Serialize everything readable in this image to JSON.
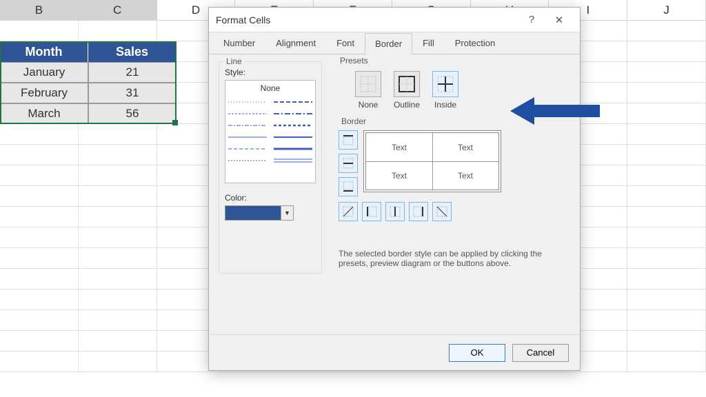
{
  "columns": [
    "B",
    "C",
    "D",
    "E",
    "F",
    "G",
    "H",
    "I",
    "J"
  ],
  "table": {
    "headers": [
      "Month",
      "Sales"
    ],
    "rows": [
      [
        "January",
        "21"
      ],
      [
        "February",
        "31"
      ],
      [
        "March",
        "56"
      ]
    ]
  },
  "dialog": {
    "title": "Format Cells",
    "help": "?",
    "close": "✕",
    "tabs": [
      "Number",
      "Alignment",
      "Font",
      "Border",
      "Fill",
      "Protection"
    ],
    "active_tab": "Border",
    "line": {
      "group": "Line",
      "style_label": "Style:",
      "none": "None",
      "color_label": "Color:",
      "color_value": "#2f5597"
    },
    "presets": {
      "group": "Presets",
      "items": [
        "None",
        "Outline",
        "Inside"
      ]
    },
    "border": {
      "group": "Border",
      "preview_text": "Text"
    },
    "hint": "The selected border style can be applied by clicking the presets, preview diagram or the buttons above.",
    "ok": "OK",
    "cancel": "Cancel"
  },
  "chart_data": {
    "type": "table",
    "title": "",
    "columns": [
      "Month",
      "Sales"
    ],
    "rows": [
      {
        "Month": "January",
        "Sales": 21
      },
      {
        "Month": "February",
        "Sales": 31
      },
      {
        "Month": "March",
        "Sales": 56
      }
    ]
  }
}
